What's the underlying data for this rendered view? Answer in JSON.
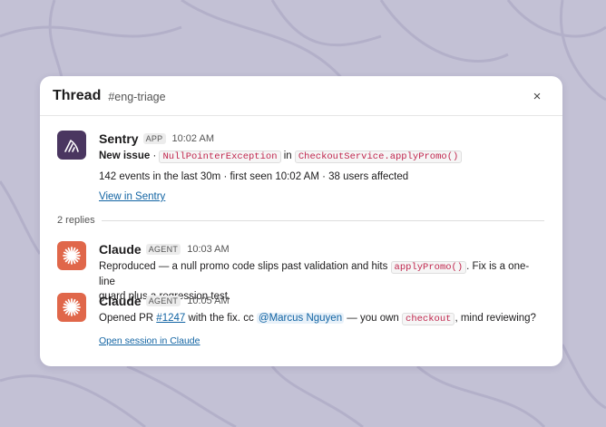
{
  "thread": {
    "title": "Thread",
    "channel": "#eng-triage",
    "close_label": "×"
  },
  "sentry_message": {
    "author": "Sentry",
    "badge": "APP",
    "time": "10:02 AM",
    "avatar_icon": "sentry-logo-icon",
    "prefix": "New issue",
    "separator": " · ",
    "exception": "NullPointerException",
    "in_word": "in",
    "location": "CheckoutService.applyPromo()",
    "stats": "142 events in the last 30m · first seen 10:02 AM · 38 users affected",
    "link_text": "View in Sentry"
  },
  "replies": {
    "count_label": "2 replies"
  },
  "claude_message_1": {
    "author": "Claude",
    "badge": "AGENT",
    "time": "10:03 AM",
    "avatar_icon": "claude-sunburst-icon",
    "text_before": "Reproduced — a null promo code slips past validation and hits ",
    "code": "applyPromo()",
    "text_after_line1": ". Fix is a one-line",
    "text_line2": "guard plus a regression test."
  },
  "claude_message_2": {
    "author": "Claude",
    "badge": "AGENT",
    "time": "10:05 AM",
    "avatar_icon": "claude-sunburst-icon",
    "text_before": "Opened PR ",
    "pr_link": "#1247",
    "text_middle": " with the fix. cc ",
    "mention": "@Marcus Nguyen",
    "text_after_mention": " — you own ",
    "code": "checkout",
    "text_end": ", mind reviewing?",
    "session_link": "Open session in Claude"
  },
  "colors": {
    "background": "#c3c1d5",
    "sentry_avatar": "#4a3660",
    "claude_avatar": "#e0674a",
    "link": "#1264a3",
    "code_text": "#c0274e"
  }
}
